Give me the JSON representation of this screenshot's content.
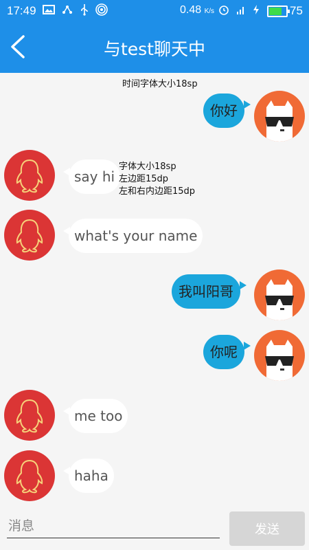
{
  "status_bar": {
    "time": "17:49",
    "speed_value": "0.48",
    "speed_unit": "K/s",
    "network": "4G",
    "battery_percent": "75",
    "battery_level": 0.75
  },
  "header": {
    "title": "与test聊天中",
    "back_icon": "chevron-left-icon",
    "bg_color": "#1e8fe8"
  },
  "annotations": {
    "time_note": "时间字体大小18sp",
    "bubble_notes": [
      "字体大小18sp",
      "左边距15dp",
      "左和右内边距15dp"
    ]
  },
  "messages": [
    {
      "side": "right",
      "text": "你好",
      "avatar": "cat-sunglasses-avatar"
    },
    {
      "side": "left",
      "text": "say hi",
      "avatar": "qq-penguin-avatar"
    },
    {
      "side": "left",
      "text": "what's your name",
      "avatar": "qq-penguin-avatar"
    },
    {
      "side": "right",
      "text": "我叫阳哥",
      "avatar": "cat-sunglasses-avatar"
    },
    {
      "side": "right",
      "text": "你呢",
      "avatar": "cat-sunglasses-avatar"
    },
    {
      "side": "left",
      "text": "me too",
      "avatar": "qq-penguin-avatar"
    },
    {
      "side": "left",
      "text": "haha",
      "avatar": "qq-penguin-avatar"
    }
  ],
  "input_bar": {
    "placeholder": "消息",
    "value": "",
    "send_label": "发送"
  },
  "colors": {
    "accent": "#1e8fe8",
    "bubble_right": "#1ba6dc",
    "bubble_left": "#ffffff",
    "avatar_left": "#db3535",
    "avatar_right": "#f06a35"
  }
}
